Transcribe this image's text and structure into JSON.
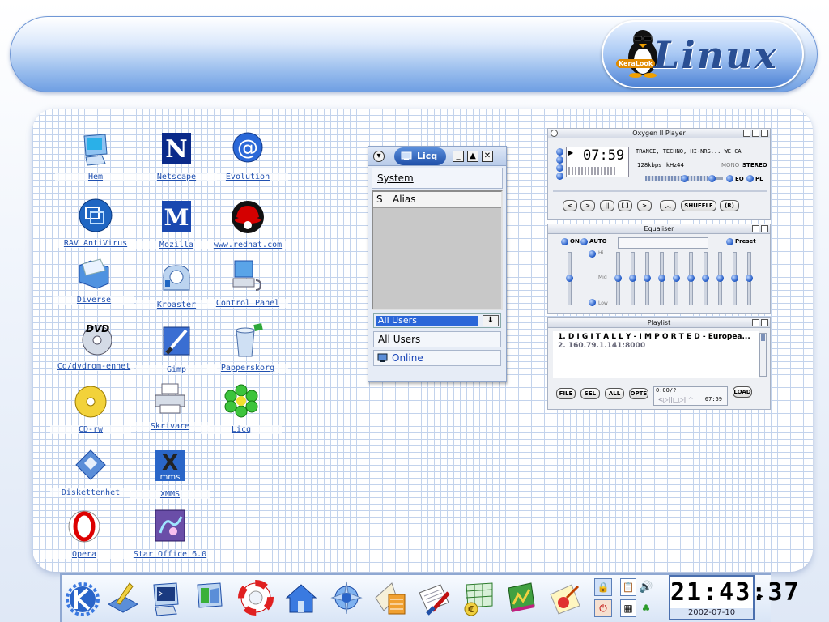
{
  "banner": {
    "logo_text": "Linux",
    "logo_badge": "KeraLook"
  },
  "desktop": {
    "icons": [
      {
        "label": "Hem",
        "icon": "monitor-home-icon"
      },
      {
        "label": "Netscape",
        "icon": "netscape-icon"
      },
      {
        "label": "Evolution",
        "icon": "evolution-at-icon"
      },
      {
        "label": "RAV AntiVirus",
        "icon": "antivirus-icon"
      },
      {
        "label": "Mozilla",
        "icon": "mozilla-icon"
      },
      {
        "label": "www.redhat.com",
        "icon": "redhat-icon"
      },
      {
        "label": "Diverse",
        "icon": "folder-icon"
      },
      {
        "label": "Kroaster",
        "icon": "cd-burner-icon"
      },
      {
        "label": "Control Panel",
        "icon": "control-panel-icon"
      },
      {
        "label": "Cd/dvdrom-enhet",
        "icon": "dvd-icon"
      },
      {
        "label": "Gimp",
        "icon": "gimp-icon"
      },
      {
        "label": "Papperskorg",
        "icon": "trash-icon"
      },
      {
        "label": "CD-rw",
        "icon": "cdrw-icon"
      },
      {
        "label": "Skrivare",
        "icon": "printer-icon"
      },
      {
        "label": "Licq",
        "icon": "licq-flower-icon"
      },
      {
        "label": "Diskettenhet",
        "icon": "floppy-icon"
      },
      {
        "label": "XMMS",
        "icon": "xmms-icon"
      },
      {
        "label": "Opera",
        "icon": "opera-icon"
      },
      {
        "label": "Star Office 6.0",
        "icon": "staroffice-icon"
      }
    ]
  },
  "licq": {
    "tab_label": "Licq",
    "menu_system": "System",
    "col_s": "S",
    "col_alias": "Alias",
    "combo_value": "All Users",
    "field_all_users": "All Users",
    "status": "Online"
  },
  "xmms": {
    "player_title": "Oxygen II Player",
    "time": "07:59",
    "track_title": "TRANCE, TECHNO, HI-NRG... WE CA",
    "kbps": "128",
    "kbps_unit": "kbps",
    "khz": "44",
    "khz_unit": "kHz",
    "mono": "MONO",
    "stereo": "STEREO",
    "eq_toggle": "EQ",
    "pl_toggle": "PL",
    "shuffle": "SHUFFLE",
    "repeat": "(R)",
    "eq_title": "Equaliser",
    "eq_on": "ON",
    "eq_auto": "AUTO",
    "eq_preset": "Preset",
    "eq_hi": "Hi",
    "eq_mid": "Mid",
    "eq_low": "Low",
    "pl_title": "Playlist",
    "playlist": [
      "1. D I G I T A L L Y - I M P O R T E D - Europea...",
      "2. 160.79.1.141:8000"
    ],
    "pl_file": "FILE",
    "pl_sel": "SEL",
    "pl_all": "ALL",
    "pl_opts": "OPTS",
    "pl_load": "LOAD",
    "pl_counter": "0:00/?",
    "pl_time": "07:59"
  },
  "taskbar": {
    "icons": [
      "kde-menu-icon",
      "desktop-icon",
      "terminal-icon",
      "system-monitor-icon",
      "help-lifebuoy-icon",
      "home-icon",
      "konqueror-icon",
      "kmail-icon",
      "text-editor-icon",
      "spreadsheet-icon",
      "presentation-icon",
      "drawing-icon"
    ],
    "clock_time": "21:43:37",
    "clock_date": "2002-07-10"
  },
  "colors": {
    "accent": "#1f4fa8",
    "link": "#2050b0",
    "grid": "#c3d3ec"
  }
}
